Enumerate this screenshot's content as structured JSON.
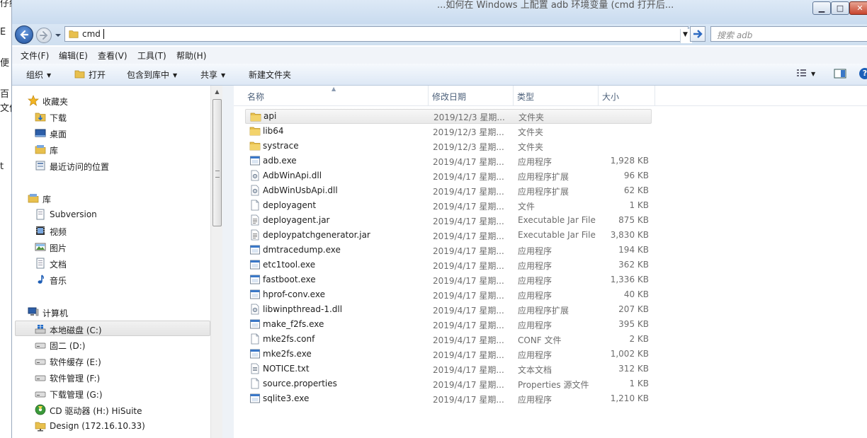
{
  "background_fragments": [
    "仔细细",
    "E",
    "便",
    "百",
    "文件",
    "t"
  ],
  "background_title": "...如何在 Windows 上配置 adb 环境变量 (cmd 打开后...",
  "window": {
    "minimize": "▁",
    "maximize": "□",
    "close": "✕"
  },
  "address": {
    "path": "cmd",
    "search_placeholder": "搜索 adb"
  },
  "menu": [
    "文件(F)",
    "编辑(E)",
    "查看(V)",
    "工具(T)",
    "帮助(H)"
  ],
  "toolbar": {
    "organize": "组织",
    "open": "打开",
    "include_library": "包含到库中",
    "share": "共享",
    "new_folder": "新建文件夹",
    "help": "?"
  },
  "nav": {
    "favorites": {
      "label": "收藏夹",
      "items": [
        "下载",
        "桌面",
        "库",
        "最近访问的位置"
      ]
    },
    "libraries": {
      "label": "库",
      "items": [
        "Subversion",
        "视频",
        "图片",
        "文档",
        "音乐"
      ]
    },
    "computer": {
      "label": "计算机",
      "items": [
        "本地磁盘 (C:)",
        "固二 (D:)",
        "软件缓存 (E:)",
        "软件管理 (F:)",
        "下载管理 (G:)",
        "CD 驱动器 (H:) HiSuite",
        "Design (172.16.10.33)"
      ]
    }
  },
  "columns": {
    "name": "名称",
    "date": "修改日期",
    "type": "类型",
    "size": "大小"
  },
  "files": [
    {
      "name": "api",
      "date": "2019/12/3 星期...",
      "type": "文件夹",
      "size": "",
      "icon": "folder-icon"
    },
    {
      "name": "lib64",
      "date": "2019/12/3 星期...",
      "type": "文件夹",
      "size": "",
      "icon": "folder-icon"
    },
    {
      "name": "systrace",
      "date": "2019/12/3 星期...",
      "type": "文件夹",
      "size": "",
      "icon": "folder-icon"
    },
    {
      "name": "adb.exe",
      "date": "2019/4/17 星期...",
      "type": "应用程序",
      "size": "1,928 KB",
      "icon": "exe-icon"
    },
    {
      "name": "AdbWinApi.dll",
      "date": "2019/4/17 星期...",
      "type": "应用程序扩展",
      "size": "96 KB",
      "icon": "dll-icon"
    },
    {
      "name": "AdbWinUsbApi.dll",
      "date": "2019/4/17 星期...",
      "type": "应用程序扩展",
      "size": "62 KB",
      "icon": "dll-icon"
    },
    {
      "name": "deployagent",
      "date": "2019/4/17 星期...",
      "type": "文件",
      "size": "1 KB",
      "icon": "file-icon"
    },
    {
      "name": "deployagent.jar",
      "date": "2019/4/17 星期...",
      "type": "Executable Jar File",
      "size": "875 KB",
      "icon": "jar-icon"
    },
    {
      "name": "deploypatchgenerator.jar",
      "date": "2019/4/17 星期...",
      "type": "Executable Jar File",
      "size": "3,830 KB",
      "icon": "jar-icon"
    },
    {
      "name": "dmtracedump.exe",
      "date": "2019/4/17 星期...",
      "type": "应用程序",
      "size": "194 KB",
      "icon": "exe-icon"
    },
    {
      "name": "etc1tool.exe",
      "date": "2019/4/17 星期...",
      "type": "应用程序",
      "size": "362 KB",
      "icon": "exe-icon"
    },
    {
      "name": "fastboot.exe",
      "date": "2019/4/17 星期...",
      "type": "应用程序",
      "size": "1,336 KB",
      "icon": "exe-icon"
    },
    {
      "name": "hprof-conv.exe",
      "date": "2019/4/17 星期...",
      "type": "应用程序",
      "size": "40 KB",
      "icon": "exe-icon"
    },
    {
      "name": "libwinpthread-1.dll",
      "date": "2019/4/17 星期...",
      "type": "应用程序扩展",
      "size": "207 KB",
      "icon": "dll-icon"
    },
    {
      "name": "make_f2fs.exe",
      "date": "2019/4/17 星期...",
      "type": "应用程序",
      "size": "395 KB",
      "icon": "exe-icon"
    },
    {
      "name": "mke2fs.conf",
      "date": "2019/4/17 星期...",
      "type": "CONF 文件",
      "size": "2 KB",
      "icon": "file-icon"
    },
    {
      "name": "mke2fs.exe",
      "date": "2019/4/17 星期...",
      "type": "应用程序",
      "size": "1,002 KB",
      "icon": "exe-icon"
    },
    {
      "name": "NOTICE.txt",
      "date": "2019/4/17 星期...",
      "type": "文本文档",
      "size": "312 KB",
      "icon": "txt-icon"
    },
    {
      "name": "source.properties",
      "date": "2019/4/17 星期...",
      "type": "Properties 源文件",
      "size": "1 KB",
      "icon": "file-icon"
    },
    {
      "name": "sqlite3.exe",
      "date": "2019/4/17 星期...",
      "type": "应用程序",
      "size": "1,210 KB",
      "icon": "exe-icon"
    }
  ]
}
